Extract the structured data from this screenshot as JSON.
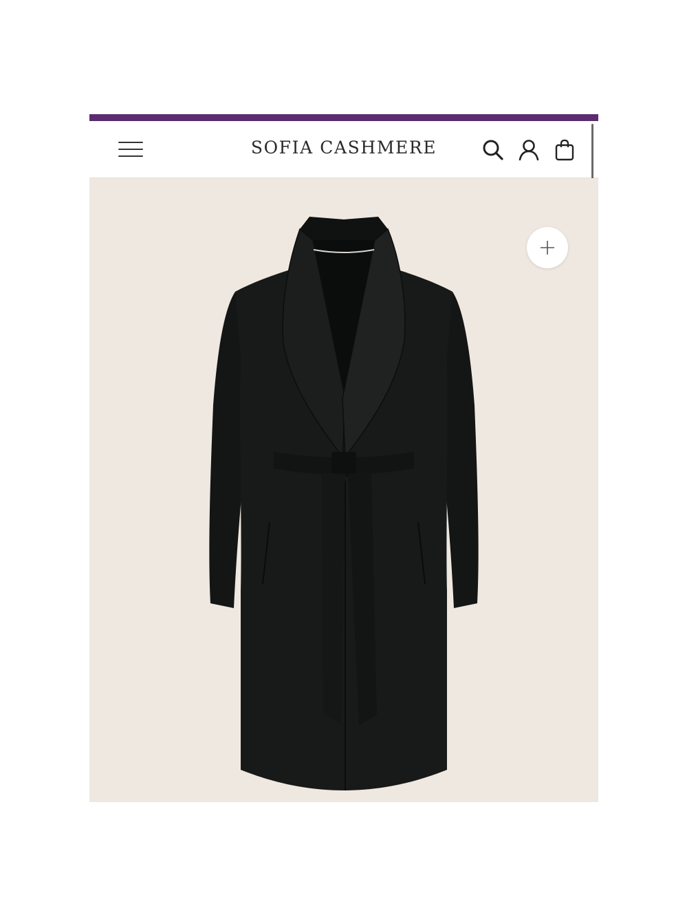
{
  "header": {
    "brand": "SOFIA CASHMERE",
    "accent_color": "#5b2d6e",
    "icons": [
      "menu-icon",
      "search-icon",
      "account-icon",
      "shopping-bag-icon"
    ]
  },
  "product": {
    "image": "black-shawl-collar-belted-coat",
    "background_color": "#efe8e1",
    "zoom_icon": "plus-icon"
  }
}
